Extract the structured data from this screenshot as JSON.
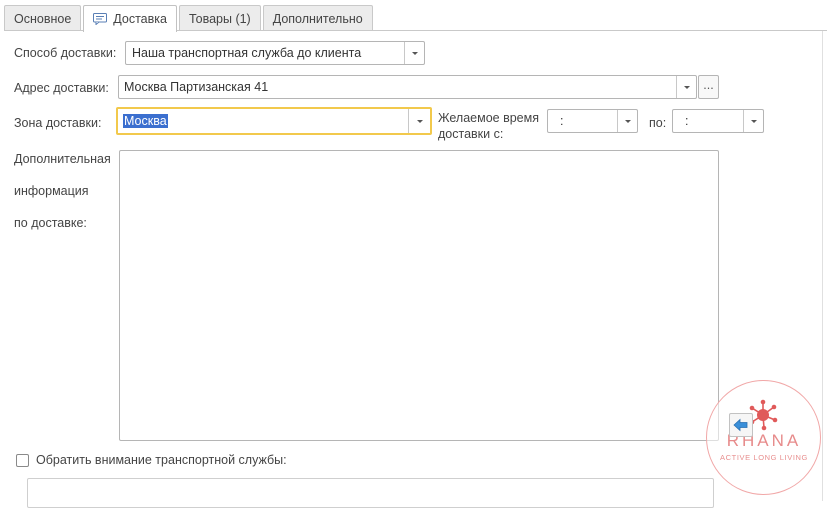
{
  "tabs": [
    {
      "label": "Основное",
      "active": false
    },
    {
      "label": "Доставка",
      "active": true,
      "icon": "chat-bubble-icon"
    },
    {
      "label": "Товары (1)",
      "active": false
    },
    {
      "label": "Дополнительно",
      "active": false
    }
  ],
  "delivery": {
    "method_label": "Способ доставки:",
    "method_value": "Наша транспортная служба до клиента",
    "address_label": "Адрес доставки:",
    "address_value": "Москва  Партизанская 41",
    "address_more": "...",
    "zone_label": "Зона доставки:",
    "zone_value": "Москва",
    "time_label_1": "Желаемое время",
    "time_label_2": "доставки с:",
    "time_from_value": ":",
    "time_to_label": "по:",
    "time_to_value": ":",
    "info_label_1": "Дополнительная",
    "info_label_2": "информация",
    "info_label_3": "по доставке:",
    "info_value": "",
    "attention_label": "Обратить внимание транспортной службы:",
    "attention_checked": false
  },
  "logo": {
    "word": "RHANA",
    "tagline": "ACTIVE LONG LIVING"
  },
  "colors": {
    "focus_border": "#f2c94c",
    "selection": "#3b6fcf",
    "logo": "#e78b8b"
  }
}
